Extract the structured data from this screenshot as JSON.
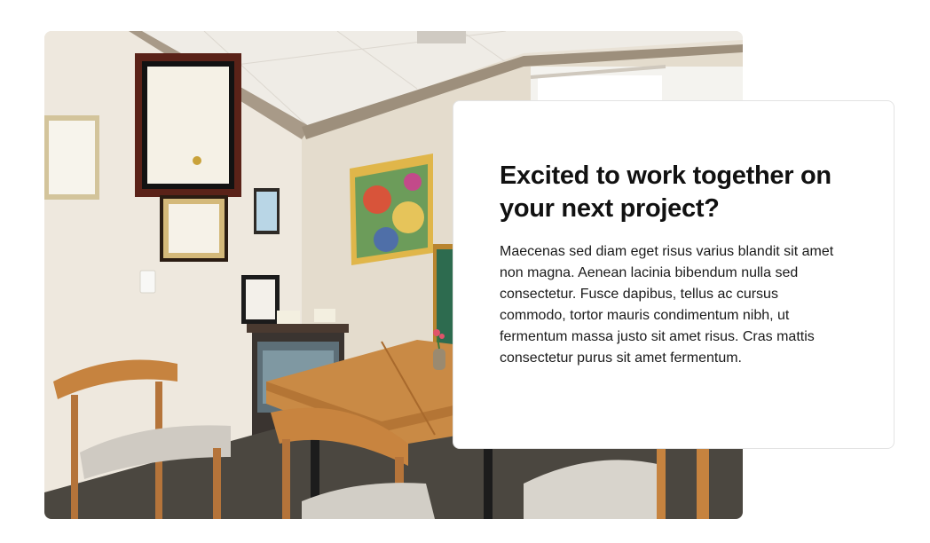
{
  "feature": {
    "photo_alt": "Office meeting room with wooden table, chairs, framed certificates and colorful painting",
    "heading": "Excited to work together on your next project?",
    "body": "Maecenas sed diam eget risus varius blandit sit amet non magna. Aenean lacinia bibendum nulla sed consectetur. Fusce dapibus, tellus ac cursus commodo, tortor mauris condimentum nibh, ut fermentum massa justo sit amet risus. Cras mattis consectetur purus sit amet fermentum."
  },
  "colors": {
    "heading": "#111111",
    "body_text": "#1a1a1a",
    "card_border": "#e3e3e3",
    "wall": "#ede6da",
    "wood": "#c98a45",
    "ceiling_trim": "#a89a88"
  }
}
